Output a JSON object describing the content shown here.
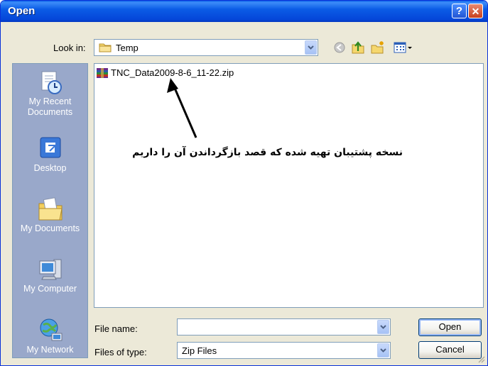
{
  "window": {
    "title": "Open"
  },
  "titlebar": {
    "help_glyph": "?",
    "close_glyph": "✕"
  },
  "lookin": {
    "label": "Look in:",
    "value": "Temp",
    "icon": "folder-icon"
  },
  "toolbar": {
    "icons": [
      "back-icon",
      "up-folder-icon",
      "new-folder-icon",
      "views-menu-icon"
    ]
  },
  "places": [
    {
      "label": "My Recent Documents",
      "icon": "recent-documents-icon"
    },
    {
      "label": "Desktop",
      "icon": "desktop-icon"
    },
    {
      "label": "My Documents",
      "icon": "my-documents-icon"
    },
    {
      "label": "My Computer",
      "icon": "my-computer-icon"
    },
    {
      "label": "My Network",
      "icon": "my-network-icon"
    }
  ],
  "files": [
    {
      "name": "TNC_Data2009-8-6_11-22.zip",
      "icon": "zip-archive-icon"
    }
  ],
  "annotation": {
    "text": "نسخه پشتیبان تهیه شده که قصد بازگرداندن آن را داریم",
    "color": "#000000"
  },
  "filename": {
    "label": "File name:",
    "value": ""
  },
  "filetype": {
    "label": "Files of type:",
    "value": "Zip Files"
  },
  "buttons": {
    "open": "Open",
    "cancel": "Cancel"
  },
  "colors": {
    "titlebar": "#0b5ce6",
    "dialog": "#ece9d8",
    "places_bar": "#99a8ca",
    "border": "#7f9db9"
  }
}
